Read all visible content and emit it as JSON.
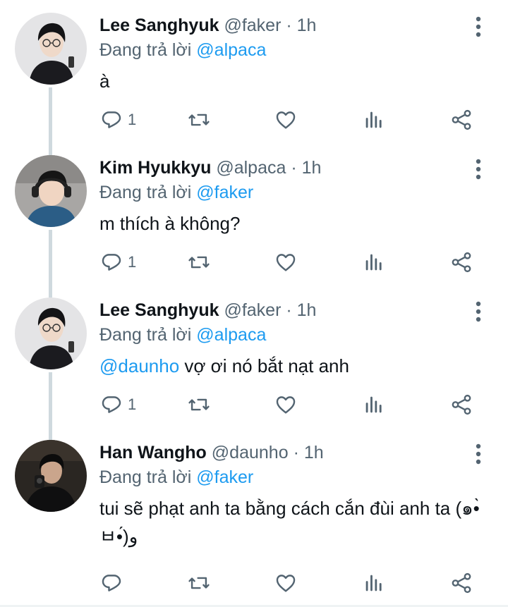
{
  "tweets": [
    {
      "name": "Lee Sanghyuk",
      "handle": "@faker",
      "time": "· 1h",
      "replying_prefix": "Đang trả lời",
      "replying_to": "@alpaca",
      "text_mention": "",
      "text": "à",
      "reply_count": "1",
      "avatar": "avatar-faker"
    },
    {
      "name": "Kim Hyukkyu",
      "handle": "@alpaca",
      "time": "· 1h",
      "replying_prefix": "Đang trả lời",
      "replying_to": "@faker",
      "text_mention": "",
      "text": "m thích à không?",
      "reply_count": "1",
      "avatar": "avatar-alpaca"
    },
    {
      "name": "Lee Sanghyuk",
      "handle": "@faker",
      "time": "· 1h",
      "replying_prefix": "Đang trả lời",
      "replying_to": "@alpaca",
      "text_mention": "@daunho",
      "text": " vợ ơi nó bắt nạt anh",
      "reply_count": "1",
      "avatar": "avatar-faker"
    },
    {
      "name": "Han Wangho",
      "handle": "@daunho",
      "time": "· 1h",
      "replying_prefix": "Đang trả lời",
      "replying_to": "@faker",
      "text_mention": "",
      "text": "tui sẽ phạt anh ta bằng cách cắn đùi anh ta (๑•̀ㅂ•́)و",
      "reply_count": "",
      "avatar": "avatar-daunho"
    }
  ],
  "icons": {
    "reply": "reply-icon",
    "retweet": "retweet-icon",
    "like": "heart-icon",
    "views": "analytics-icon",
    "share": "share-icon",
    "more": "more-vertical-icon"
  },
  "colors": {
    "mention": "#1d9bf0",
    "secondary_text": "#536471",
    "thread_line": "#cfd9de"
  }
}
